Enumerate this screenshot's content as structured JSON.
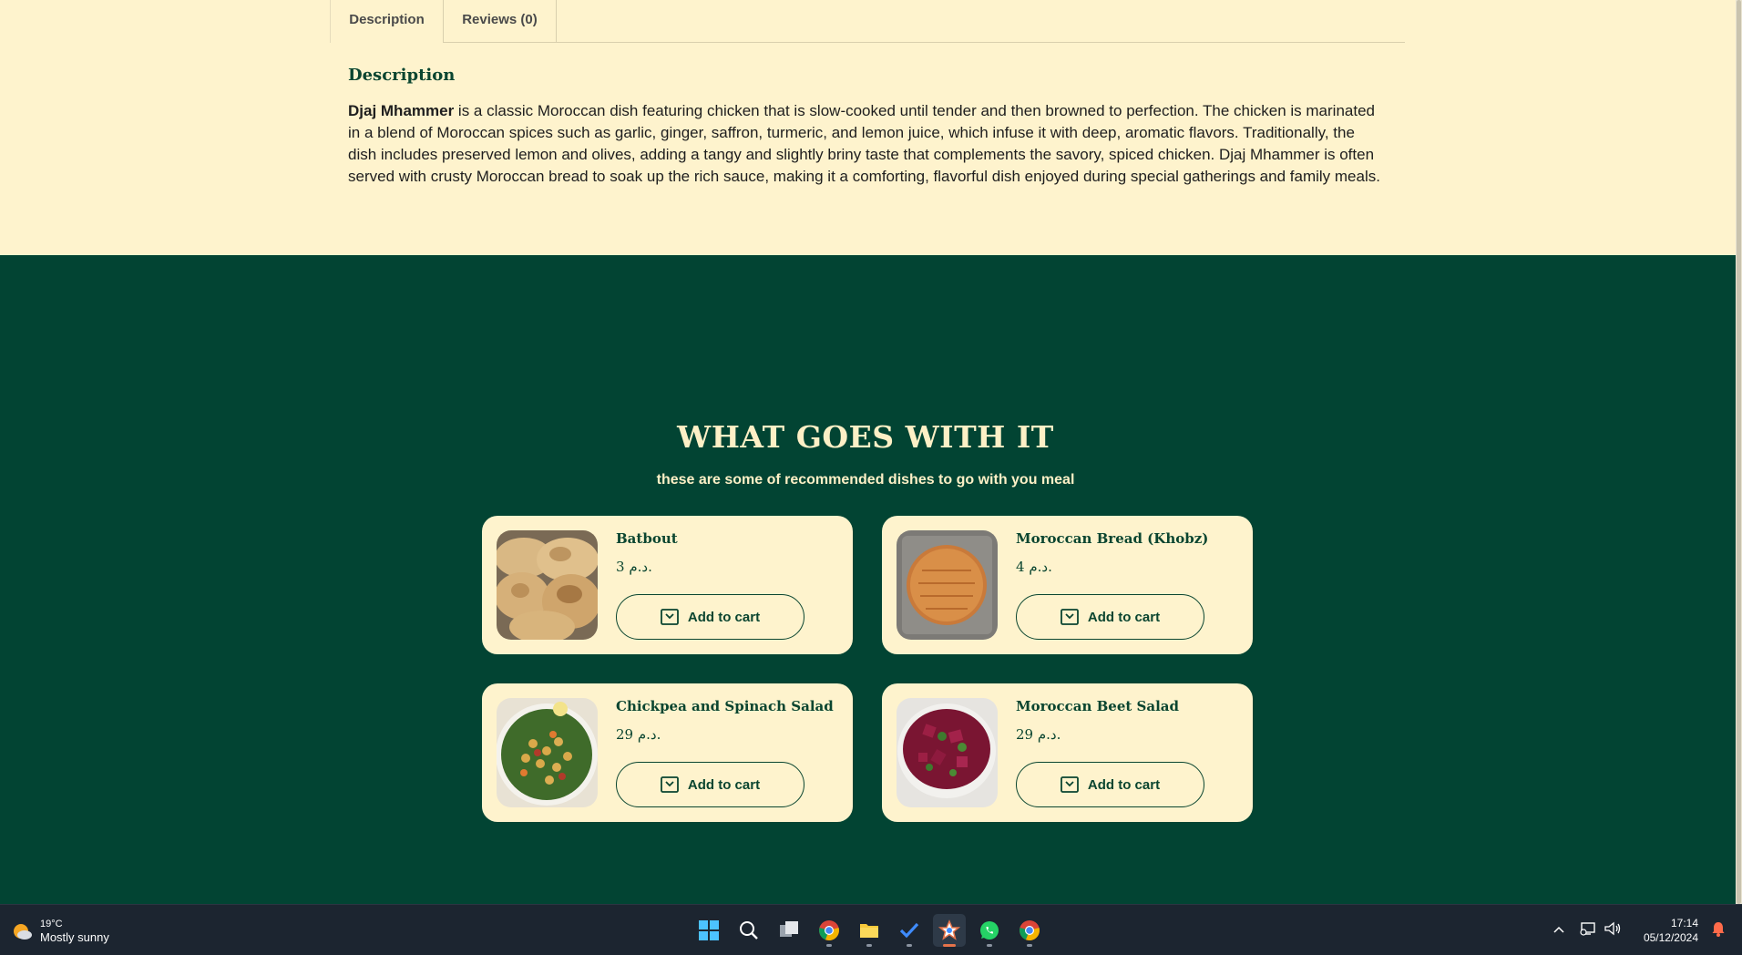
{
  "tabs": [
    {
      "label": "Description"
    },
    {
      "label": "Reviews (0)"
    }
  ],
  "description": {
    "heading": "Description",
    "dish_name": "Djaj Mhammer",
    "text": " is a classic Moroccan dish featuring chicken that is slow-cooked until tender and then browned to perfection. The chicken is marinated in a blend of Moroccan spices such as garlic, ginger, saffron, turmeric, and lemon juice, which infuse it with deep, aromatic flavors. Traditionally, the dish includes preserved lemon and olives, adding a tangy and slightly briny taste that complements the savory, spiced chicken. Djaj Mhammer is often served with crusty Moroccan bread to soak up the rich sauce, making it a comforting, flavorful dish enjoyed during special gatherings and family meals."
  },
  "pairing": {
    "title": "WHAT GOES WITH IT",
    "subtitle": "these are some of recommended dishes to go with you meal",
    "button_label": "Add to cart",
    "products": [
      {
        "name": "Batbout",
        "price": "3 د.م."
      },
      {
        "name": "Moroccan Bread (Khobz)",
        "price": "4 د.م."
      },
      {
        "name": "Chickpea and Spinach Salad",
        "price": "29 د.م."
      },
      {
        "name": "Moroccan Beet Salad",
        "price": "29 د.م."
      }
    ]
  },
  "taskbar": {
    "weather_temp": "19°C",
    "weather_condition": "Mostly sunny",
    "time": "17:14",
    "date": "05/12/2024",
    "apps": [
      "start-icon",
      "search-icon",
      "task-view-icon",
      "chrome-icon",
      "file-explorer-icon",
      "todo-icon",
      "active-app-icon",
      "whatsapp-icon",
      "chrome-profile-icon"
    ]
  },
  "colors": {
    "cream": "#fef3cd",
    "green": "#024433",
    "text_green": "#0a4530"
  }
}
